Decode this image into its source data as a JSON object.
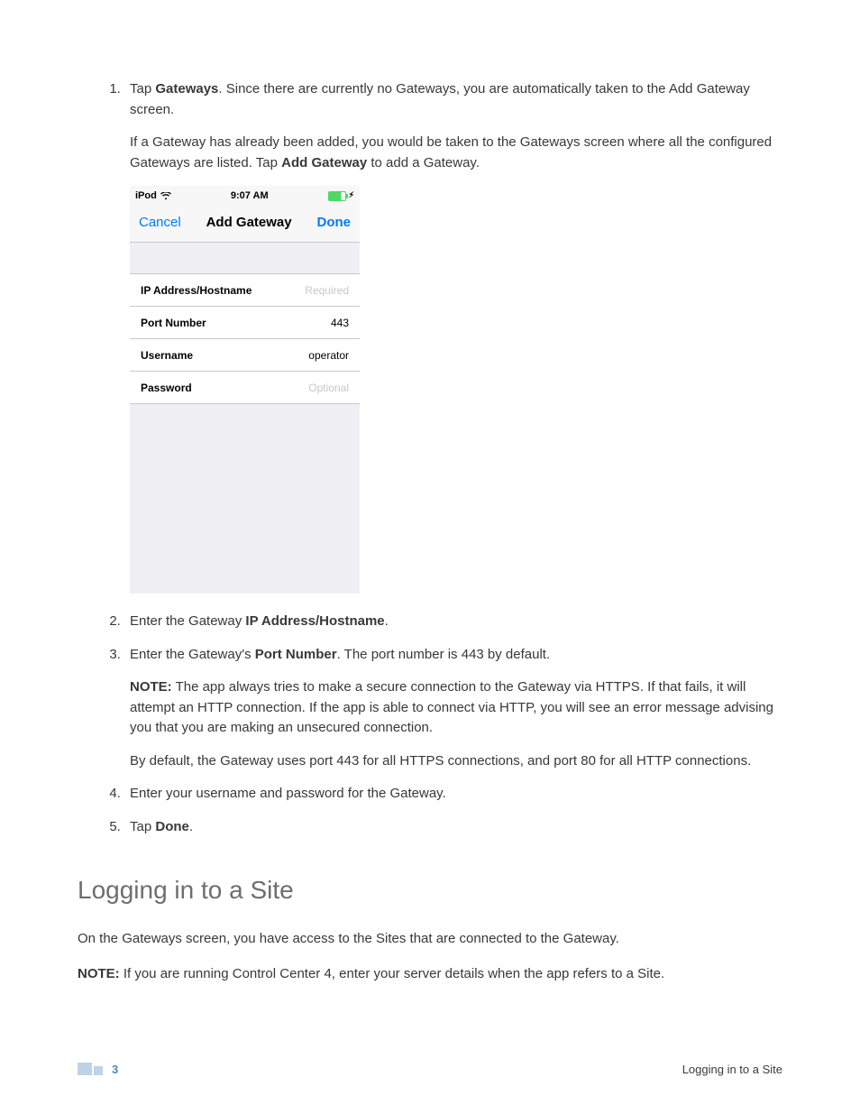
{
  "steps": {
    "s1": {
      "num": "1.",
      "pre": "Tap ",
      "bold": "Gateways",
      "post": ". Since there are currently no Gateways, you are automatically taken to the Add Gateway screen.",
      "p2a": "If a Gateway has already been added, you would be taken to the Gateways screen where all the configured Gateways are listed. Tap ",
      "p2b": "Add Gateway",
      "p2c": " to add a Gateway."
    },
    "s2": {
      "pre": "Enter the Gateway ",
      "bold": "IP Address/Hostname",
      "post": "."
    },
    "s3": {
      "pre": "Enter the Gateway's ",
      "bold": "Port Number",
      "post": ". The port number is 443 by default.",
      "noteLabel": "NOTE:",
      "noteText": " The app always tries to make a secure connection to the Gateway via HTTPS. If that fails, it will attempt an HTTP connection. If the app is able to connect via HTTP, you will see an error message advising you that you are making an unsecured connection.",
      "p2": "By default, the Gateway uses port 443 for all HTTPS connections, and port 80 for all HTTP connections."
    },
    "s4": {
      "text": "Enter your username and password for the Gateway."
    },
    "s5": {
      "pre": "Tap ",
      "bold": "Done",
      "post": "."
    }
  },
  "phone": {
    "carrier": "iPod",
    "time": "9:07 AM",
    "cancel": "Cancel",
    "title": "Add Gateway",
    "done": "Done",
    "rows": {
      "ip": {
        "label": "IP Address/Hostname",
        "placeholder": "Required"
      },
      "port": {
        "label": "Port Number",
        "value": "443"
      },
      "user": {
        "label": "Username",
        "value": "operator"
      },
      "pass": {
        "label": "Password",
        "placeholder": "Optional"
      }
    }
  },
  "section": {
    "heading": "Logging in to a Site",
    "p1": "On the Gateways screen, you have access to the Sites that are connected to the Gateway.",
    "noteLabel": "NOTE:",
    "noteText": " If you are running Control Center 4, enter your server details when the app refers to a Site."
  },
  "footer": {
    "page": "3",
    "right": "Logging in to a Site"
  }
}
